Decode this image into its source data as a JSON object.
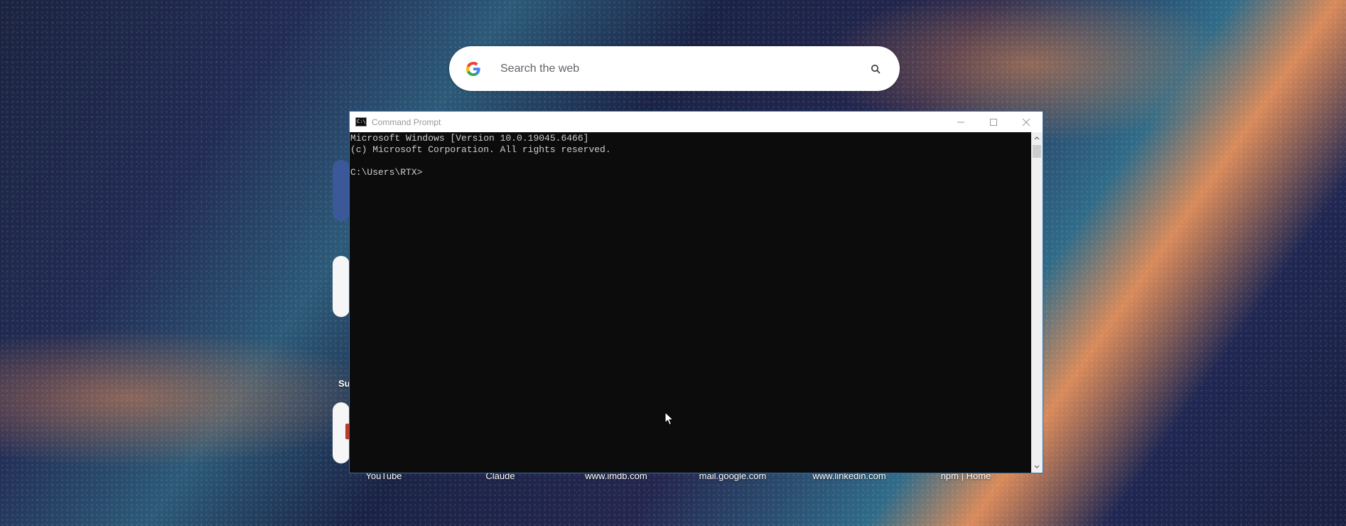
{
  "search": {
    "placeholder": "Search the web",
    "logo_icon": "google-g-icon",
    "submit_icon": "search-icon"
  },
  "sections": {
    "suggested_label": "Su"
  },
  "shortcuts": [
    {
      "label": "YouTube"
    },
    {
      "label": "Claude"
    },
    {
      "label": "www.imdb.com"
    },
    {
      "label": "mail.google.com"
    },
    {
      "label": "www.linkedin.com"
    },
    {
      "label": "npm | Home"
    }
  ],
  "cmd": {
    "title": "Command Prompt",
    "icon_text": "C:\\",
    "lines": [
      "Microsoft Windows [Version 10.0.19045.6466]",
      "(c) Microsoft Corporation. All rights reserved.",
      "",
      "C:\\Users\\RTX>"
    ],
    "controls": [
      "minimize-icon",
      "maximize-icon",
      "close-icon"
    ]
  },
  "colors": {
    "console_bg": "#0c0c0c",
    "console_text": "#cccccc",
    "google_blue": "#4285F4",
    "google_red": "#EA4335",
    "google_yellow": "#FBBC05",
    "google_green": "#34A853"
  }
}
